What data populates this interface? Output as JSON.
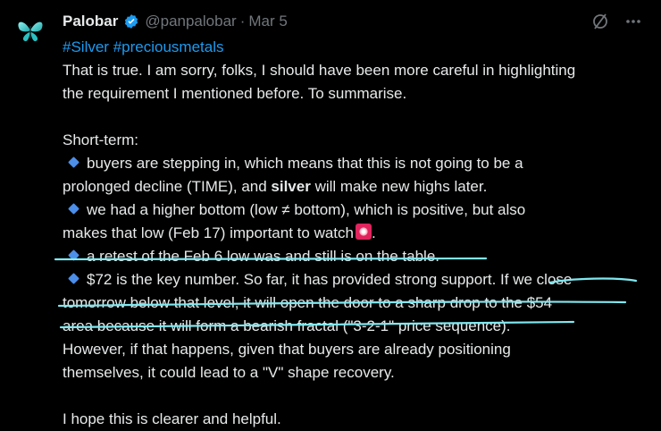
{
  "author": {
    "name": "Palobar",
    "handle": "@panpalobar",
    "separator": "·",
    "date": "Mar 5"
  },
  "icons": {
    "avatar": "butterfly-avatar",
    "verified": "verified-badge-icon",
    "grok": "grok-icon",
    "more": "more-options-icon"
  },
  "colors": {
    "accent": "#1d9bf0",
    "bullet": "#4c8ee8",
    "annotation": "#7fe8f0"
  },
  "tweet": {
    "hashtag1": "#Silver",
    "hashtag2": "#preciousmetals",
    "line_intro1": "That is true. I am sorry, folks, I should have been more careful in highlighting",
    "line_intro2": "the requirement I mentioned before. To summarise.",
    "short_term": "Short-term:",
    "b1_l1": "buyers are stepping in, which means that this is not going to be a",
    "b1_l2a": "prolonged decline (TIME), and ",
    "b1_bold": "silver",
    "b1_l2b": " will make new highs later.",
    "b2_l1": "we had a higher bottom (low ≠ bottom), which is positive, but also",
    "b2_l2": "makes that low (Feb 17) important to watch",
    "b2_end": ".",
    "b3": "a retest of the Feb 6 low was and still is on the table.",
    "b4_l1": "$72 is the key number. So far, it has provided strong support. If we close",
    "b4_l2": "tomorrow below that level, it will open the door to a sharp drop to the $54",
    "b4_l3": "area because it will form a bearish fractal (\"3-2-1\" price sequence).",
    "after_l1": "However, if that happens, given that buyers are already positioning",
    "after_l2": "themselves, it could lead to a \"V\" shape recovery.",
    "closing": "I hope this is clearer and helpful."
  }
}
